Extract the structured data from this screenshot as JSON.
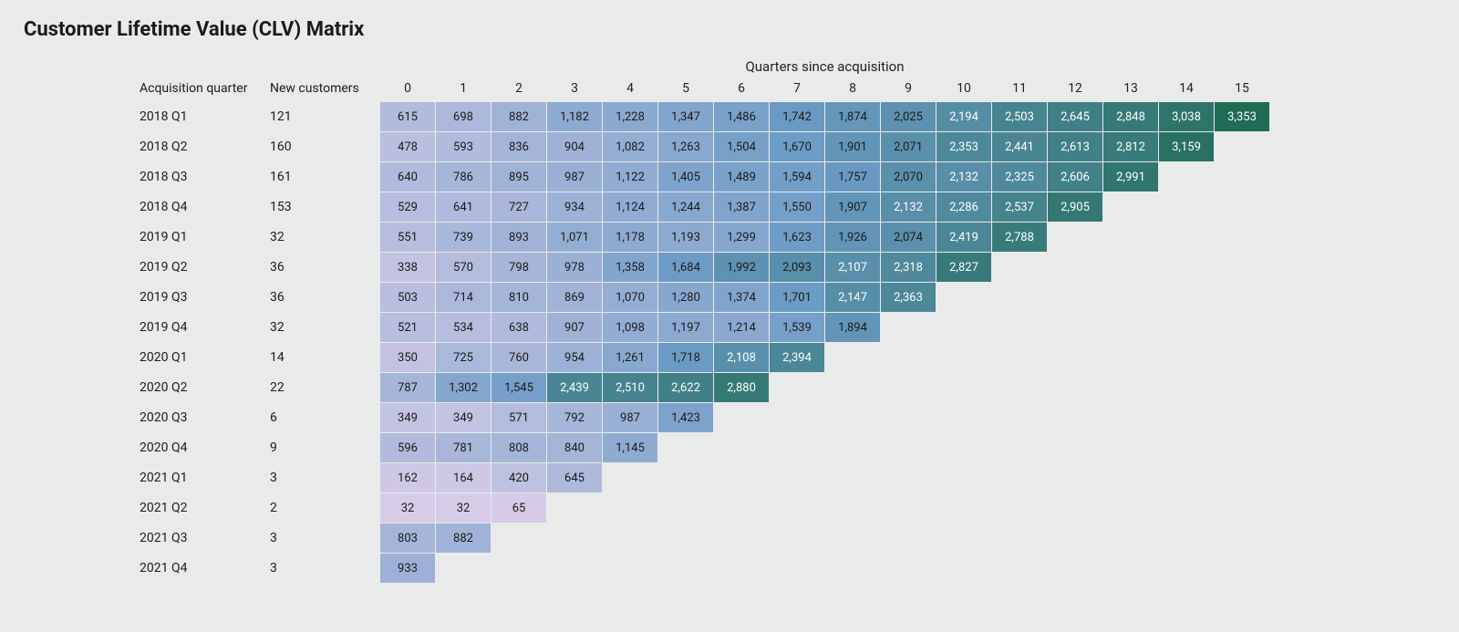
{
  "title": "Customer Lifetime Value (CLV) Matrix",
  "columns_title": "Quarters since acquisition",
  "row_label_header": "Acquisition quarter",
  "new_customers_header": "New customers",
  "chart_data": {
    "type": "heatmap",
    "title": "Customer Lifetime Value (CLV) Matrix",
    "xlabel": "Quarters since acquisition",
    "ylabel": "Acquisition quarter",
    "x_categories": [
      0,
      1,
      2,
      3,
      4,
      5,
      6,
      7,
      8,
      9,
      10,
      11,
      12,
      13,
      14,
      15
    ],
    "rows": [
      {
        "quarter": "2018 Q1",
        "new_customers": 121,
        "values": [
          615,
          698,
          882,
          1182,
          1228,
          1347,
          1486,
          1742,
          1874,
          2025,
          2194,
          2503,
          2645,
          2848,
          3038,
          3353
        ]
      },
      {
        "quarter": "2018 Q2",
        "new_customers": 160,
        "values": [
          478,
          593,
          836,
          904,
          1082,
          1263,
          1504,
          1670,
          1901,
          2071,
          2353,
          2441,
          2613,
          2812,
          3159
        ]
      },
      {
        "quarter": "2018 Q3",
        "new_customers": 161,
        "values": [
          640,
          786,
          895,
          987,
          1122,
          1405,
          1489,
          1594,
          1757,
          2070,
          2132,
          2325,
          2606,
          2991
        ]
      },
      {
        "quarter": "2018 Q4",
        "new_customers": 153,
        "values": [
          529,
          641,
          727,
          934,
          1124,
          1244,
          1387,
          1550,
          1907,
          2132,
          2286,
          2537,
          2905
        ]
      },
      {
        "quarter": "2019 Q1",
        "new_customers": 32,
        "values": [
          551,
          739,
          893,
          1071,
          1178,
          1193,
          1299,
          1623,
          1926,
          2074,
          2419,
          2788
        ]
      },
      {
        "quarter": "2019 Q2",
        "new_customers": 36,
        "values": [
          338,
          570,
          798,
          978,
          1358,
          1684,
          1992,
          2093,
          2107,
          2318,
          2827
        ]
      },
      {
        "quarter": "2019 Q3",
        "new_customers": 36,
        "values": [
          503,
          714,
          810,
          869,
          1070,
          1280,
          1374,
          1701,
          2147,
          2363
        ]
      },
      {
        "quarter": "2019 Q4",
        "new_customers": 32,
        "values": [
          521,
          534,
          638,
          907,
          1098,
          1197,
          1214,
          1539,
          1894
        ]
      },
      {
        "quarter": "2020 Q1",
        "new_customers": 14,
        "values": [
          350,
          725,
          760,
          954,
          1261,
          1718,
          2108,
          2394
        ]
      },
      {
        "quarter": "2020 Q2",
        "new_customers": 22,
        "values": [
          787,
          1302,
          1545,
          2439,
          2510,
          2622,
          2880
        ]
      },
      {
        "quarter": "2020 Q3",
        "new_customers": 6,
        "values": [
          349,
          349,
          571,
          792,
          987,
          1423
        ]
      },
      {
        "quarter": "2020 Q4",
        "new_customers": 9,
        "values": [
          596,
          781,
          808,
          840,
          1145
        ]
      },
      {
        "quarter": "2021 Q1",
        "new_customers": 3,
        "values": [
          162,
          164,
          420,
          645
        ]
      },
      {
        "quarter": "2021 Q2",
        "new_customers": 2,
        "values": [
          32,
          32,
          65
        ]
      },
      {
        "quarter": "2021 Q3",
        "new_customers": 3,
        "values": [
          803,
          882
        ]
      },
      {
        "quarter": "2021 Q4",
        "new_customers": 3,
        "values": [
          933
        ]
      }
    ],
    "color_scale": {
      "min": 32,
      "max": 3353,
      "low": "#d7cce8",
      "mid": "#6c9bc6",
      "high": "#1f6b55"
    }
  }
}
